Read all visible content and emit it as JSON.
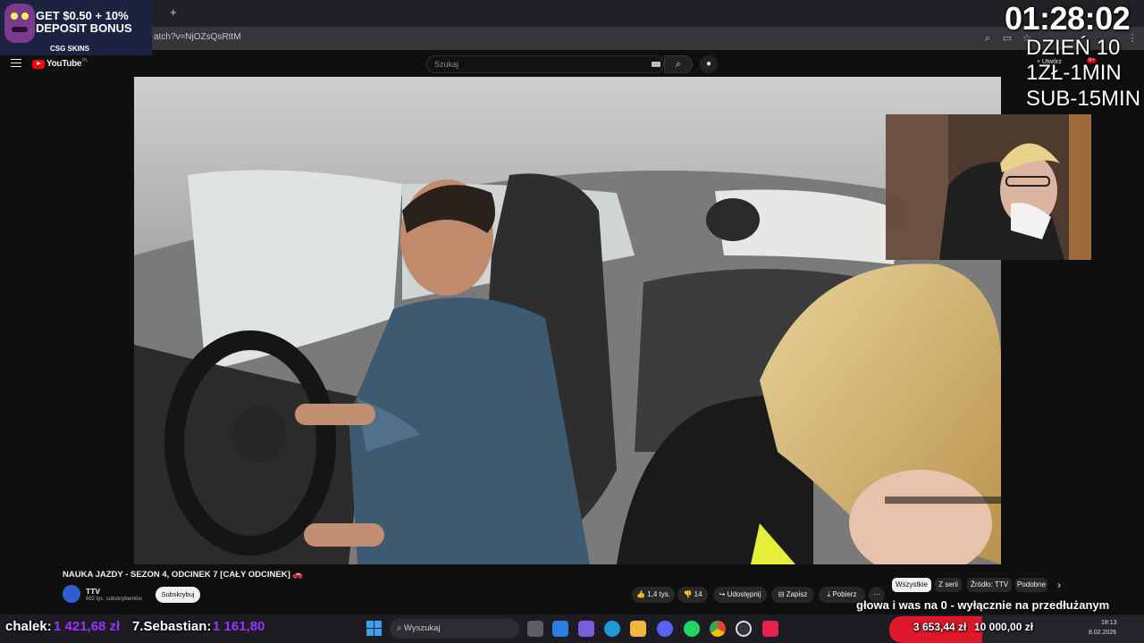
{
  "browser": {
    "url": "atch?v=NjOZsQsRttM",
    "new_tab": "+"
  },
  "ad": {
    "headline1": "GET $0.50 + 10%",
    "headline2": "DEPOSIT BONUS",
    "brand": "CSG SKINS"
  },
  "youtube": {
    "logo": "YouTube",
    "region": "PL",
    "search_placeholder": "Szukaj",
    "create_label": "Utwórz",
    "notif_badge": "9+"
  },
  "stream_overlay": {
    "timer": "01:28:02",
    "line1": "DZIEŃ 10",
    "line2": "1ZŁ-1MIN",
    "line3": "SUB-15MIN"
  },
  "video_info": {
    "title": "NAUKA JAZDY - SEZON 4, ODCINEK 7 [CAŁY ODCINEK] 🚗",
    "channel": "TTV",
    "subscribers": "692 tys. subskrybentów",
    "subscribe": "Subskrybuj",
    "likes": "1,4 tys.",
    "dislikes": "14",
    "share": "Udostępnij",
    "save": "Zapisz",
    "download": "Pobierz",
    "more": "···"
  },
  "chips": [
    "Wszystkie",
    "Z serii",
    "Źródło: TTV",
    "Podobne"
  ],
  "ticker": {
    "item1_name": "chalek:",
    "item1_value": "1 421,68 zł",
    "item2_name": "7.Sebastian:",
    "item2_value": "1 161,80"
  },
  "caption": "głowa i was na 0 - wyłącznie na przedłużanym",
  "donations": {
    "goal": "3 653,44 zł",
    "target": "10 000,00 zł"
  },
  "taskbar": {
    "search": "Wyszukaj",
    "time": "18:13",
    "date": "8.02.2026"
  },
  "colors": {
    "ticker_value": "#9b30ff",
    "donation_bar": "#e0182b",
    "youtube_red": "#ff0000"
  }
}
